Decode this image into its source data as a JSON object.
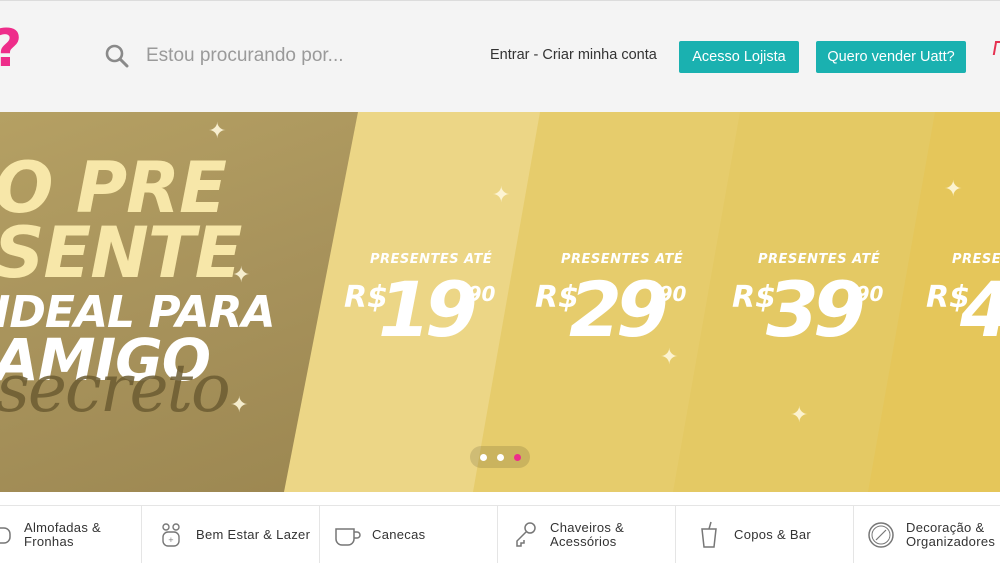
{
  "header": {
    "logo_text": "?",
    "search": {
      "placeholder": "Estou procurando por...",
      "icon": "search-icon"
    },
    "login_link": "Entrar - Criar minha conta",
    "buttons": {
      "lojista": "Acesso Lojista",
      "vender": "Quero vender Uatt?"
    },
    "colors": {
      "brand": "#ee2d8a",
      "accent": "#1ab1b0"
    }
  },
  "banner": {
    "promo": {
      "line1": "O PRE",
      "line2": "SENTE",
      "line3": "IDEAL PARA",
      "line4": "AMIGO",
      "script": "secreto"
    },
    "prices": [
      {
        "label": "PRESENTES ATÉ",
        "currency": "R$",
        "value": "19",
        "cents": ",90"
      },
      {
        "label": "PRESENTES ATÉ",
        "currency": "R$",
        "value": "29",
        "cents": ",90"
      },
      {
        "label": "PRESENTES ATÉ",
        "currency": "R$",
        "value": "39",
        "cents": ",90"
      },
      {
        "label": "PRESENTES ATÉ",
        "currency": "R$",
        "value": "4",
        "cents": ""
      }
    ],
    "carousel": {
      "slides": 3,
      "active_slide": 3
    }
  },
  "categories": [
    {
      "label": "Almofadas & Fronhas",
      "icon": "pillow-icon"
    },
    {
      "label": "Bem Estar & Lazer",
      "icon": "wellness-icon"
    },
    {
      "label": "Canecas",
      "icon": "mug-icon"
    },
    {
      "label": "Chaveiros & Acessórios",
      "icon": "keychain-icon"
    },
    {
      "label": "Copos & Bar",
      "icon": "cup-icon"
    },
    {
      "label": "Decoração & Organizadores",
      "icon": "decoration-icon"
    }
  ]
}
